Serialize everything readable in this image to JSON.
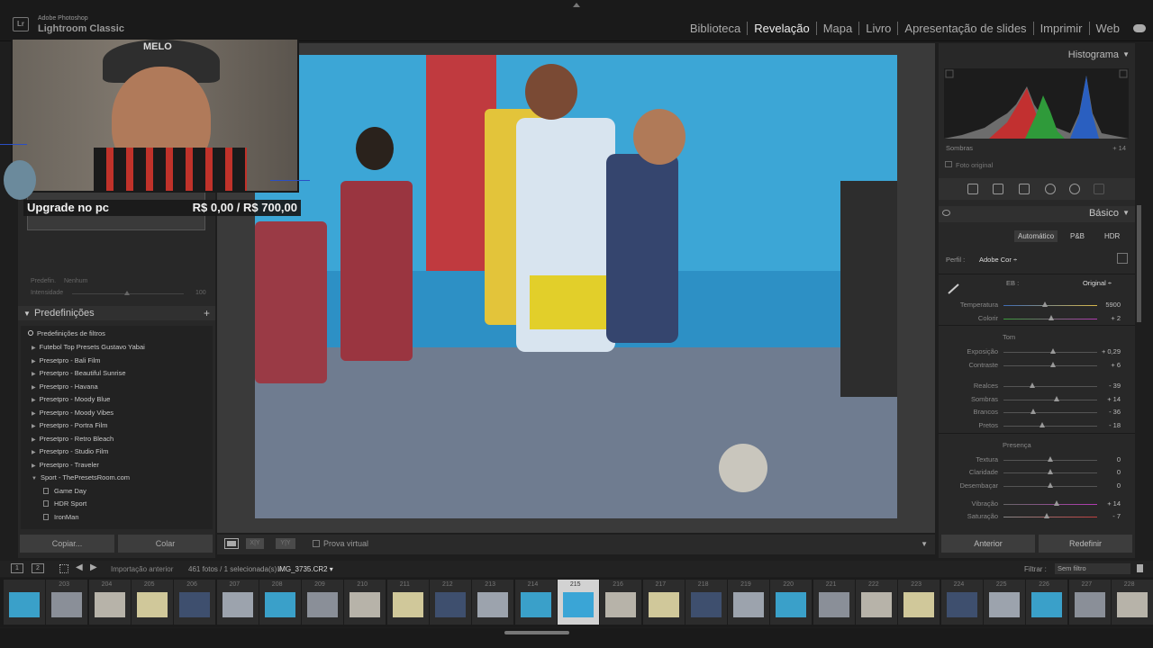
{
  "app": {
    "name": "Adobe Photoshop",
    "sub": "Lightroom Classic"
  },
  "modules": [
    {
      "label": "Biblioteca",
      "active": false
    },
    {
      "label": "Revelação",
      "active": true
    },
    {
      "label": "Mapa",
      "active": false
    },
    {
      "label": "Livro",
      "active": false
    },
    {
      "label": "Apresentação de slides",
      "active": false
    },
    {
      "label": "Imprimir",
      "active": false
    },
    {
      "label": "Web",
      "active": false
    }
  ],
  "webcam": {
    "logo": "MELO",
    "upgrade_text": "Upgrade no pc",
    "upgrade_price": "R$ 0,00 / R$ 700,00"
  },
  "left_panel": {
    "preset_label": "Predefin.",
    "preset_value": "Nenhum",
    "amount_label": "Intensidade",
    "amount_value": "100",
    "presets_title": "Predefinições",
    "filter_item": "Predefinições de filtros",
    "presets": [
      "Futebol Top Presets Gustavo Yabai",
      "Presetpro - Bali Film",
      "Presetpro - Beautiful Sunrise",
      "Presetpro - Havana",
      "Presetpro - Moody Blue",
      "Presetpro - Moody Vibes",
      "Presetpro - Portra Film",
      "Presetpro - Retro Bleach",
      "Presetpro - Studio Film",
      "Presetpro - Traveler",
      "Sport - ThePresetsRoom.com"
    ],
    "sub_presets": [
      "Game Day",
      "HDR Sport",
      "IronMan"
    ],
    "copy_label": "Copiar...",
    "paste_label": "Colar"
  },
  "toolbar": {
    "softproof_label": "Prova virtual",
    "compare_label": "X|Y",
    "survey_label": "Y|Y"
  },
  "right_panel": {
    "histogram_title": "Histograma",
    "histo_shadow_label": "Sombras",
    "histo_shadow_value": "+ 14",
    "original_label": "Foto original",
    "basic_title": "Básico",
    "tabs": [
      "Automático",
      "P&B",
      "HDR"
    ],
    "profile_label": "Perfil :",
    "profile_value": "Adobe Cor ÷",
    "wb_label": "EB :",
    "wb_value": "Original ÷",
    "tone_label": "Tom",
    "presence_label": "Presença",
    "sliders": [
      {
        "label": "Temperatura",
        "value": "5900",
        "pos": 0.44
      },
      {
        "label": "Colorir",
        "value": "+ 2",
        "pos": 0.51
      },
      {
        "label": "Exposição",
        "value": "+ 0,29",
        "pos": 0.53
      },
      {
        "label": "Contraste",
        "value": "+ 6",
        "pos": 0.53
      },
      {
        "label": "Realces",
        "value": "- 39",
        "pos": 0.31
      },
      {
        "label": "Sombras",
        "value": "+ 14",
        "pos": 0.57
      },
      {
        "label": "Brancos",
        "value": "- 36",
        "pos": 0.32
      },
      {
        "label": "Pretos",
        "value": "- 18",
        "pos": 0.41
      },
      {
        "label": "Textura",
        "value": "0",
        "pos": 0.5
      },
      {
        "label": "Claridade",
        "value": "0",
        "pos": 0.5
      },
      {
        "label": "Desembaçar",
        "value": "0",
        "pos": 0.5
      },
      {
        "label": "Vibração",
        "value": "+ 14",
        "pos": 0.57
      },
      {
        "label": "Saturação",
        "value": "- 7",
        "pos": 0.46
      }
    ],
    "prev_label": "Anterior",
    "reset_label": "Redefinir"
  },
  "filmbar": {
    "btn1": "1",
    "btn2": "2",
    "import_label": "Importação anterior",
    "photo_count": "461 fotos / 1 selecionada(s) /",
    "filename": "IMG_3735.CR2 ▾",
    "filter_label": "Filtrar :",
    "filter_value": "Sem filtro"
  },
  "filmstrip": [
    {
      "n": "",
      "active": false
    },
    {
      "n": "203",
      "active": false
    },
    {
      "n": "204",
      "active": false
    },
    {
      "n": "205",
      "active": false
    },
    {
      "n": "206",
      "active": false
    },
    {
      "n": "207",
      "active": false
    },
    {
      "n": "208",
      "active": false
    },
    {
      "n": "209",
      "active": false
    },
    {
      "n": "210",
      "active": false
    },
    {
      "n": "211",
      "active": false
    },
    {
      "n": "212",
      "active": false
    },
    {
      "n": "213",
      "active": false
    },
    {
      "n": "214",
      "active": false
    },
    {
      "n": "215",
      "active": true
    },
    {
      "n": "216",
      "active": false
    },
    {
      "n": "217",
      "active": false
    },
    {
      "n": "218",
      "active": false
    },
    {
      "n": "219",
      "active": false
    },
    {
      "n": "220",
      "active": false
    },
    {
      "n": "221",
      "active": false
    },
    {
      "n": "222",
      "active": false
    },
    {
      "n": "223",
      "active": false
    },
    {
      "n": "224",
      "active": false
    },
    {
      "n": "225",
      "active": false
    },
    {
      "n": "226",
      "active": false
    },
    {
      "n": "227",
      "active": false
    },
    {
      "n": "228",
      "active": false
    }
  ],
  "colors": {
    "accent": "#c8c8c8",
    "panel": "#282828",
    "active_cell": "#d2d2d2"
  }
}
